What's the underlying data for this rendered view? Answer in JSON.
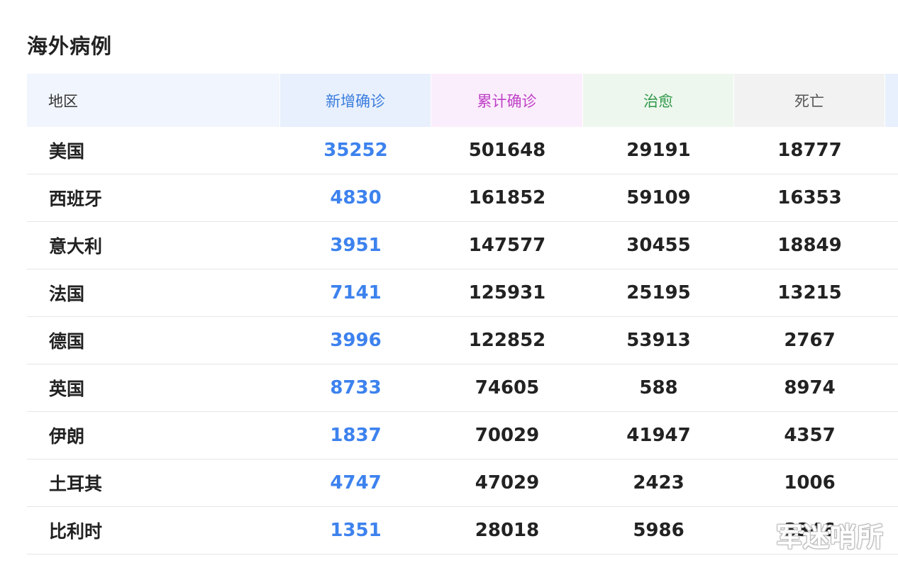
{
  "title": "海外病例",
  "table": {
    "headers": {
      "region": "地区",
      "new": "新增确诊",
      "total": "累计确诊",
      "cured": "治愈",
      "dead": "死亡"
    },
    "rows": [
      {
        "region": "美国",
        "new": "35252",
        "total": "501648",
        "cured": "29191",
        "dead": "18777"
      },
      {
        "region": "西班牙",
        "new": "4830",
        "total": "161852",
        "cured": "59109",
        "dead": "16353"
      },
      {
        "region": "意大利",
        "new": "3951",
        "total": "147577",
        "cured": "30455",
        "dead": "18849"
      },
      {
        "region": "法国",
        "new": "7141",
        "total": "125931",
        "cured": "25195",
        "dead": "13215"
      },
      {
        "region": "德国",
        "new": "3996",
        "total": "122852",
        "cured": "53913",
        "dead": "2767"
      },
      {
        "region": "英国",
        "new": "8733",
        "total": "74605",
        "cured": "588",
        "dead": "8974"
      },
      {
        "region": "伊朗",
        "new": "1837",
        "total": "70029",
        "cured": "41947",
        "dead": "4357"
      },
      {
        "region": "土耳其",
        "new": "4747",
        "total": "47029",
        "cured": "2423",
        "dead": "1006"
      },
      {
        "region": "比利时",
        "new": "1351",
        "total": "28018",
        "cured": "5986",
        "dead": "3346"
      }
    ]
  },
  "watermark": "军迷哨所",
  "colors": {
    "new": "#3d82ee",
    "total_header": "#bf40c7",
    "cured_header": "#2e9848"
  }
}
